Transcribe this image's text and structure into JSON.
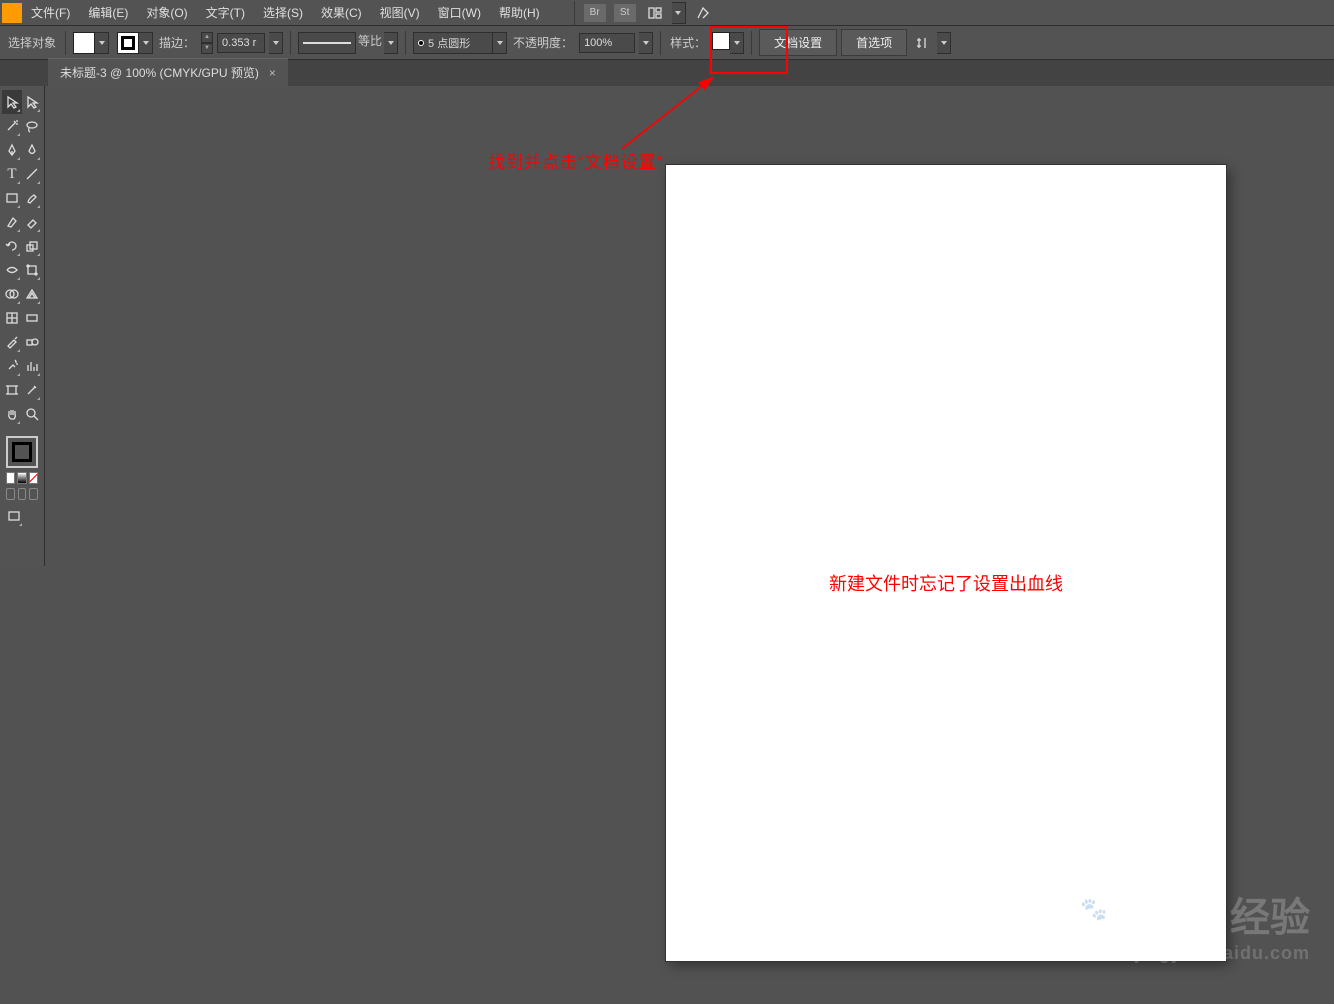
{
  "menubar": {
    "items": [
      {
        "label": "文件(F)"
      },
      {
        "label": "编辑(E)"
      },
      {
        "label": "对象(O)"
      },
      {
        "label": "文字(T)"
      },
      {
        "label": "选择(S)"
      },
      {
        "label": "效果(C)"
      },
      {
        "label": "视图(V)"
      },
      {
        "label": "窗口(W)"
      },
      {
        "label": "帮助(H)"
      }
    ],
    "icons": [
      "Br",
      "St"
    ]
  },
  "optbar": {
    "no_selection": "选择对象",
    "stroke_label": "描边：",
    "stroke_value": "0.353 r",
    "uniform_label": "等比",
    "profile_label": "5 点圆形",
    "opacity_label": "不透明度：",
    "opacity_value": "100%",
    "style_label": "样式：",
    "doc_setup": "文档设置",
    "prefs": "首选项"
  },
  "tab": {
    "title": "未标题-3 @ 100% (CMYK/GPU 预览)",
    "close": "×"
  },
  "annotations": {
    "topline": "找到并点击“文档设置”",
    "artboard_note": "新建文件时忘记了设置出血线"
  },
  "watermark": {
    "line1": "Baidu 经验",
    "line2": "jingyan.baidu.com"
  },
  "tools": [
    [
      "selection",
      "direct-select"
    ],
    [
      "magic-wand",
      "lasso"
    ],
    [
      "pen",
      "curvature"
    ],
    [
      "line",
      "shape"
    ],
    [
      "paintbrush",
      "blob-brush"
    ],
    [
      "shaper",
      "eraser"
    ],
    [
      "rotate",
      "scale"
    ],
    [
      "width",
      "free-transform"
    ],
    [
      "shape-builder",
      "perspective"
    ],
    [
      "mesh",
      "gradient"
    ],
    [
      "eyedropper",
      "blend"
    ],
    [
      "symbol-spray",
      "column-graph"
    ],
    [
      "artboard",
      "slice"
    ],
    [
      "hand",
      "zoom"
    ]
  ]
}
